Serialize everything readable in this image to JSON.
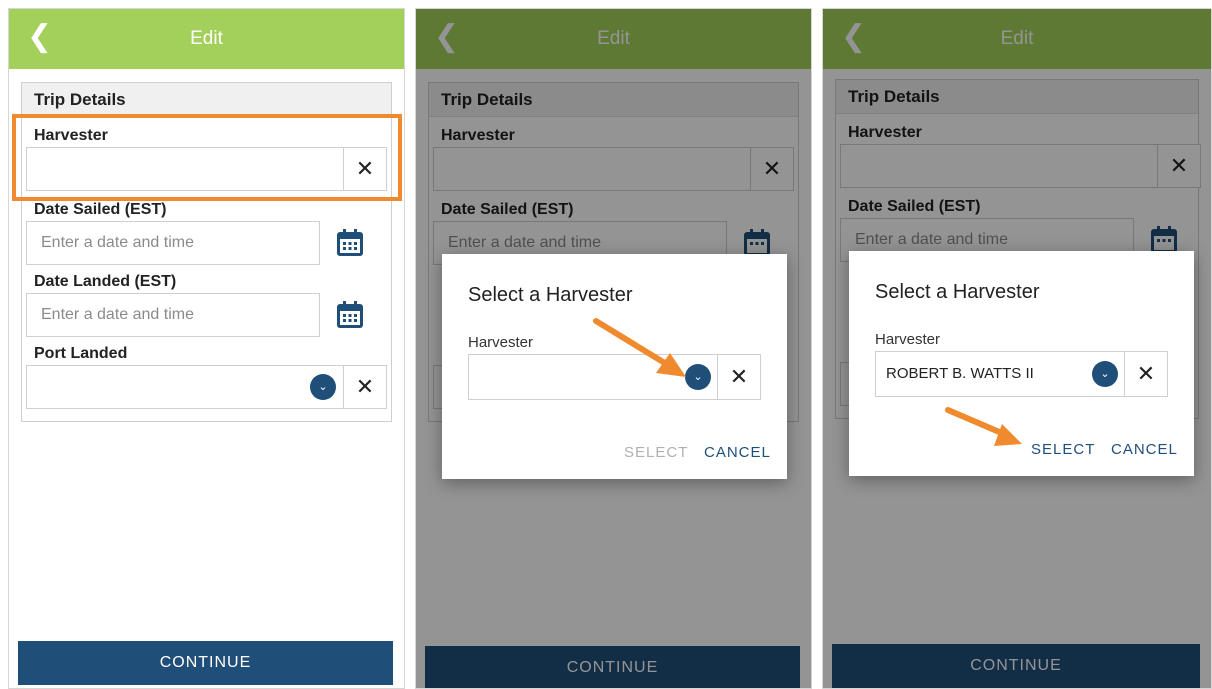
{
  "header": {
    "back_glyph": "❮",
    "title": "Edit"
  },
  "card": {
    "title": "Trip Details"
  },
  "fields": {
    "harvester_label": "Harvester",
    "date_sailed_label": "Date Sailed (EST)",
    "date_landed_label": "Date Landed (EST)",
    "port_landed_label": "Port Landed",
    "date_placeholder": "Enter a date and time",
    "clear_glyph": "✕",
    "dropdown_glyph": "⌄"
  },
  "continue_label": "CONTINUE",
  "dialog": {
    "title": "Select a Harvester",
    "field_label": "Harvester",
    "select_label": "SELECT",
    "cancel_label": "CANCEL",
    "selected_value": "ROBERT B. WATTS II"
  },
  "colors": {
    "header_green": "#a3d05a",
    "navy": "#1f4e79",
    "annotation_orange": "#ef8a2e",
    "select_disabled": "#b0b0b0"
  }
}
